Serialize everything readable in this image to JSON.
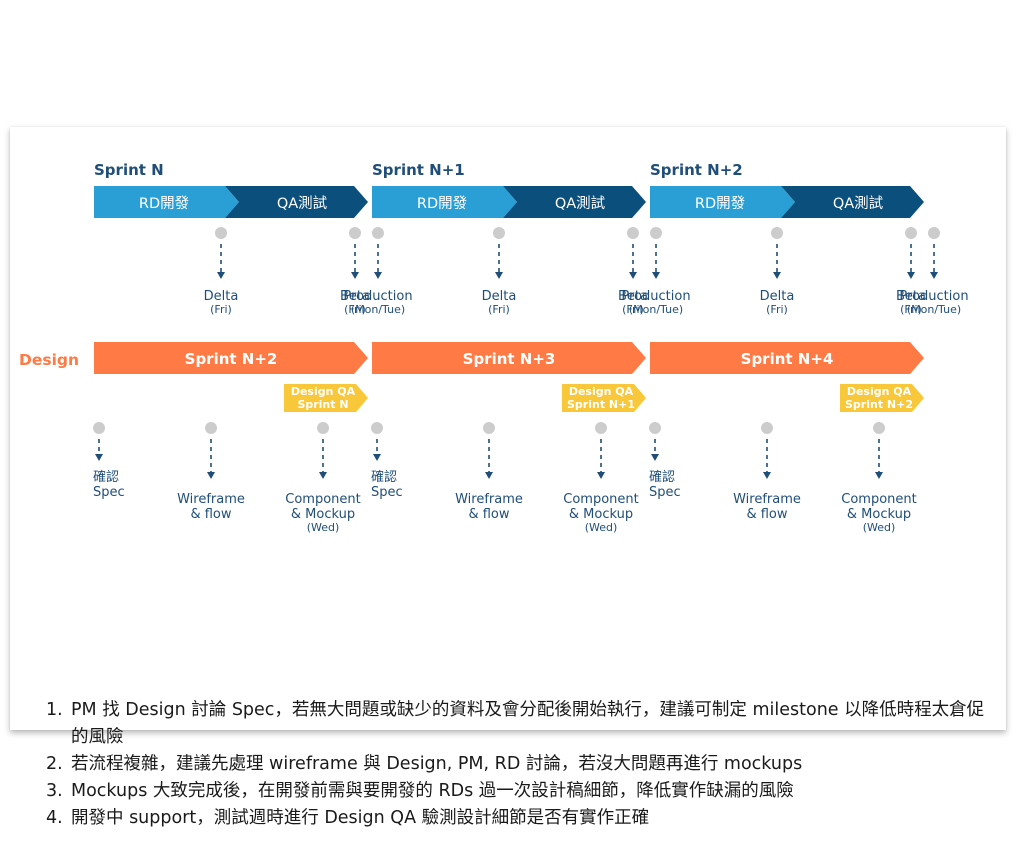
{
  "colors": {
    "sprint_title": "#1f4e79",
    "rd_phase": "#2a9fd6",
    "qa_phase": "#0b4f7c",
    "design_sprint": "#ff7a45",
    "design_qa": "#f9c73a",
    "milestone_dot": "#cccccc",
    "arrow": "#1f4e79",
    "label": "#1f4e79"
  },
  "dev_sprints": [
    {
      "title": "Sprint N",
      "rd_label": "RD開發",
      "qa_label": "QA測試",
      "milestones": [
        {
          "name": "Delta",
          "sub": "(Fri)"
        },
        {
          "name": "Beta",
          "sub": "(Fri)"
        },
        {
          "name": "Production",
          "sub": "(Mon/Tue)"
        }
      ]
    },
    {
      "title": "Sprint N+1",
      "rd_label": "RD開發",
      "qa_label": "QA測試",
      "milestones": [
        {
          "name": "Delta",
          "sub": "(Fri)"
        },
        {
          "name": "Beta",
          "sub": "(Fri)"
        },
        {
          "name": "Production",
          "sub": "(Mon/Tue)"
        }
      ]
    },
    {
      "title": "Sprint N+2",
      "rd_label": "RD開發",
      "qa_label": "QA測試",
      "milestones": [
        {
          "name": "Delta",
          "sub": "(Fri)"
        },
        {
          "name": "Beta",
          "sub": "(Fri)"
        },
        {
          "name": "Production",
          "sub": "(Mon/Tue)"
        }
      ]
    }
  ],
  "design_label": "Design",
  "design_sprints": [
    {
      "title": "Sprint N+2",
      "qa_line1": "Design QA",
      "qa_line2": "Sprint N",
      "steps": [
        {
          "line1": "確認",
          "line2": "Spec",
          "line3": ""
        },
        {
          "line1": "Wireframe",
          "line2": "& flow",
          "line3": ""
        },
        {
          "line1": "Component",
          "line2": "& Mockup",
          "line3": "(Wed)"
        }
      ]
    },
    {
      "title": "Sprint N+3",
      "qa_line1": "Design QA",
      "qa_line2": "Sprint N+1",
      "steps": [
        {
          "line1": "確認",
          "line2": "Spec",
          "line3": ""
        },
        {
          "line1": "Wireframe",
          "line2": "& flow",
          "line3": ""
        },
        {
          "line1": "Component",
          "line2": "& Mockup",
          "line3": "(Wed)"
        }
      ]
    },
    {
      "title": "Sprint N+4",
      "qa_line1": "Design QA",
      "qa_line2": "Sprint N+2",
      "steps": [
        {
          "line1": "確認",
          "line2": "Spec",
          "line3": ""
        },
        {
          "line1": "Wireframe",
          "line2": "& flow",
          "line3": ""
        },
        {
          "line1": "Component",
          "line2": "& Mockup",
          "line3": "(Wed)"
        }
      ]
    }
  ],
  "notes": [
    {
      "num": "1.",
      "text": "PM 找 Design 討論 Spec，若無大問題或缺少的資料及會分配後開始執行，建議可制定 milestone 以降低時程太倉促的風險"
    },
    {
      "num": "2.",
      "text": "若流程複雜，建議先處理 wireframe 與 Design, PM, RD 討論，若沒大問題再進行 mockups"
    },
    {
      "num": "3.",
      "text": "Mockups 大致完成後，在開發前需與要開發的 RDs 過一次設計稿細節，降低實作缺漏的風險"
    },
    {
      "num": "4.",
      "text": "開發中 support，測試週時進行 Design QA 驗測設計細節是否有實作正確"
    }
  ]
}
